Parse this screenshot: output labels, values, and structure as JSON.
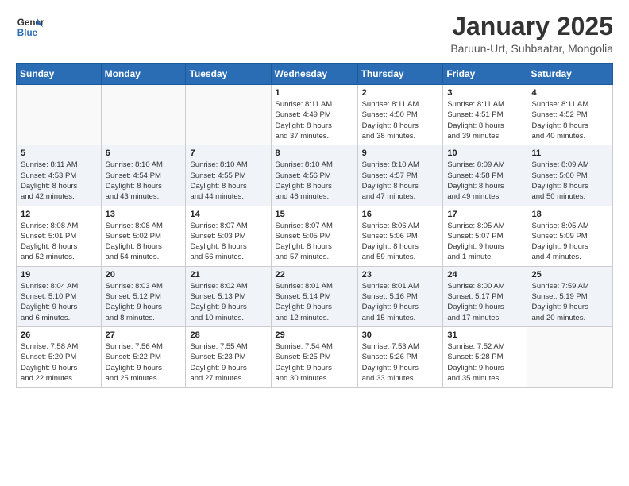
{
  "logo": {
    "text_general": "General",
    "text_blue": "Blue"
  },
  "header": {
    "title": "January 2025",
    "location": "Baruun-Urt, Suhbaatar, Mongolia"
  },
  "weekdays": [
    "Sunday",
    "Monday",
    "Tuesday",
    "Wednesday",
    "Thursday",
    "Friday",
    "Saturday"
  ],
  "weeks": [
    [
      {
        "day": "",
        "info": ""
      },
      {
        "day": "",
        "info": ""
      },
      {
        "day": "",
        "info": ""
      },
      {
        "day": "1",
        "info": "Sunrise: 8:11 AM\nSunset: 4:49 PM\nDaylight: 8 hours\nand 37 minutes."
      },
      {
        "day": "2",
        "info": "Sunrise: 8:11 AM\nSunset: 4:50 PM\nDaylight: 8 hours\nand 38 minutes."
      },
      {
        "day": "3",
        "info": "Sunrise: 8:11 AM\nSunset: 4:51 PM\nDaylight: 8 hours\nand 39 minutes."
      },
      {
        "day": "4",
        "info": "Sunrise: 8:11 AM\nSunset: 4:52 PM\nDaylight: 8 hours\nand 40 minutes."
      }
    ],
    [
      {
        "day": "5",
        "info": "Sunrise: 8:11 AM\nSunset: 4:53 PM\nDaylight: 8 hours\nand 42 minutes."
      },
      {
        "day": "6",
        "info": "Sunrise: 8:10 AM\nSunset: 4:54 PM\nDaylight: 8 hours\nand 43 minutes."
      },
      {
        "day": "7",
        "info": "Sunrise: 8:10 AM\nSunset: 4:55 PM\nDaylight: 8 hours\nand 44 minutes."
      },
      {
        "day": "8",
        "info": "Sunrise: 8:10 AM\nSunset: 4:56 PM\nDaylight: 8 hours\nand 46 minutes."
      },
      {
        "day": "9",
        "info": "Sunrise: 8:10 AM\nSunset: 4:57 PM\nDaylight: 8 hours\nand 47 minutes."
      },
      {
        "day": "10",
        "info": "Sunrise: 8:09 AM\nSunset: 4:58 PM\nDaylight: 8 hours\nand 49 minutes."
      },
      {
        "day": "11",
        "info": "Sunrise: 8:09 AM\nSunset: 5:00 PM\nDaylight: 8 hours\nand 50 minutes."
      }
    ],
    [
      {
        "day": "12",
        "info": "Sunrise: 8:08 AM\nSunset: 5:01 PM\nDaylight: 8 hours\nand 52 minutes."
      },
      {
        "day": "13",
        "info": "Sunrise: 8:08 AM\nSunset: 5:02 PM\nDaylight: 8 hours\nand 54 minutes."
      },
      {
        "day": "14",
        "info": "Sunrise: 8:07 AM\nSunset: 5:03 PM\nDaylight: 8 hours\nand 56 minutes."
      },
      {
        "day": "15",
        "info": "Sunrise: 8:07 AM\nSunset: 5:05 PM\nDaylight: 8 hours\nand 57 minutes."
      },
      {
        "day": "16",
        "info": "Sunrise: 8:06 AM\nSunset: 5:06 PM\nDaylight: 8 hours\nand 59 minutes."
      },
      {
        "day": "17",
        "info": "Sunrise: 8:05 AM\nSunset: 5:07 PM\nDaylight: 9 hours\nand 1 minute."
      },
      {
        "day": "18",
        "info": "Sunrise: 8:05 AM\nSunset: 5:09 PM\nDaylight: 9 hours\nand 4 minutes."
      }
    ],
    [
      {
        "day": "19",
        "info": "Sunrise: 8:04 AM\nSunset: 5:10 PM\nDaylight: 9 hours\nand 6 minutes."
      },
      {
        "day": "20",
        "info": "Sunrise: 8:03 AM\nSunset: 5:12 PM\nDaylight: 9 hours\nand 8 minutes."
      },
      {
        "day": "21",
        "info": "Sunrise: 8:02 AM\nSunset: 5:13 PM\nDaylight: 9 hours\nand 10 minutes."
      },
      {
        "day": "22",
        "info": "Sunrise: 8:01 AM\nSunset: 5:14 PM\nDaylight: 9 hours\nand 12 minutes."
      },
      {
        "day": "23",
        "info": "Sunrise: 8:01 AM\nSunset: 5:16 PM\nDaylight: 9 hours\nand 15 minutes."
      },
      {
        "day": "24",
        "info": "Sunrise: 8:00 AM\nSunset: 5:17 PM\nDaylight: 9 hours\nand 17 minutes."
      },
      {
        "day": "25",
        "info": "Sunrise: 7:59 AM\nSunset: 5:19 PM\nDaylight: 9 hours\nand 20 minutes."
      }
    ],
    [
      {
        "day": "26",
        "info": "Sunrise: 7:58 AM\nSunset: 5:20 PM\nDaylight: 9 hours\nand 22 minutes."
      },
      {
        "day": "27",
        "info": "Sunrise: 7:56 AM\nSunset: 5:22 PM\nDaylight: 9 hours\nand 25 minutes."
      },
      {
        "day": "28",
        "info": "Sunrise: 7:55 AM\nSunset: 5:23 PM\nDaylight: 9 hours\nand 27 minutes."
      },
      {
        "day": "29",
        "info": "Sunrise: 7:54 AM\nSunset: 5:25 PM\nDaylight: 9 hours\nand 30 minutes."
      },
      {
        "day": "30",
        "info": "Sunrise: 7:53 AM\nSunset: 5:26 PM\nDaylight: 9 hours\nand 33 minutes."
      },
      {
        "day": "31",
        "info": "Sunrise: 7:52 AM\nSunset: 5:28 PM\nDaylight: 9 hours\nand 35 minutes."
      },
      {
        "day": "",
        "info": ""
      }
    ]
  ]
}
